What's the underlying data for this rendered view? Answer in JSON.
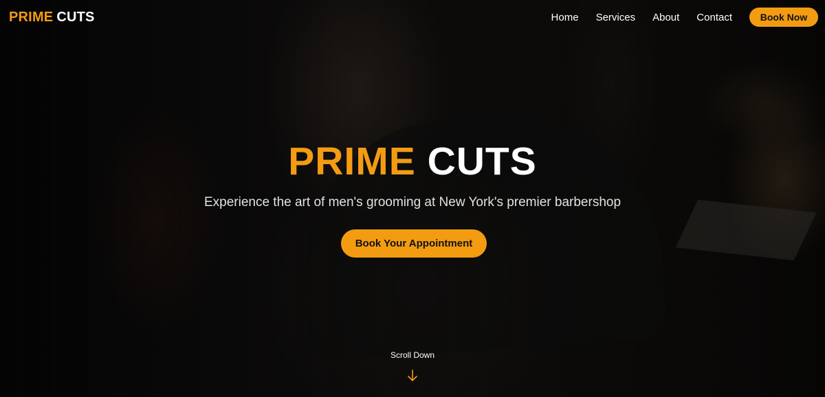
{
  "brand": {
    "accent": "PRIME",
    "main": "CUTS"
  },
  "nav": {
    "links": [
      {
        "label": "Home"
      },
      {
        "label": "Services"
      },
      {
        "label": "About"
      },
      {
        "label": "Contact"
      }
    ],
    "cta_label": "Book Now"
  },
  "hero": {
    "title_accent": "PRIME",
    "title_main": "CUTS",
    "subtitle": "Experience the art of men's grooming at New York's premier barbershop",
    "cta_label": "Book Your Appointment",
    "scroll_label": "Scroll Down",
    "scroll_icon": "arrow-down-icon",
    "background": "dark barber portrait photo"
  },
  "colors": {
    "accent": "#f39c12",
    "text": "#ffffff",
    "background": "#0d0d0d"
  }
}
